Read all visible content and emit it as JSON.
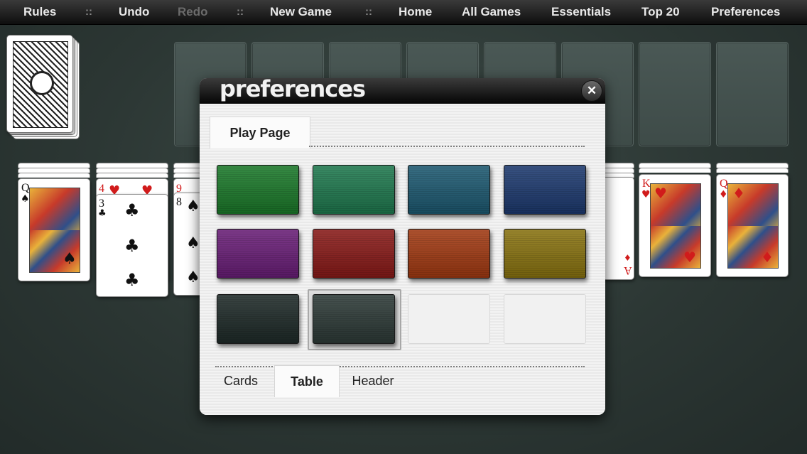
{
  "menu": {
    "rules": "Rules",
    "sep1": "::",
    "undo": "Undo",
    "redo": "Redo",
    "sep2": "::",
    "new_game": "New Game",
    "sep3": "::",
    "home": "Home",
    "all_games": "All Games",
    "essentials": "Essentials",
    "top20": "Top 20",
    "preferences": "Preferences"
  },
  "tableau": {
    "col1": {
      "rank": "Q",
      "suit": "♠",
      "color": "black"
    },
    "col2_top": {
      "rank": "4",
      "suit": "♥",
      "color": "red"
    },
    "col2": {
      "rank": "3",
      "suit": "♣",
      "color": "black"
    },
    "col3_top": {
      "rank": "9",
      "suit": "♥",
      "color": "red"
    },
    "col3": {
      "rank": "8",
      "suit": "♠",
      "color": "black"
    },
    "col7_partial": {
      "rank": "A",
      "suit": "♦",
      "color": "red"
    },
    "col8": {
      "rank": "K",
      "suit": "♥",
      "color": "red"
    },
    "col9": {
      "rank": "Q",
      "suit": "♦",
      "color": "red"
    }
  },
  "dialog": {
    "title": "preferences",
    "close_icon": "✕",
    "top_tab": "Play Page",
    "bottom_tabs": [
      "Cards",
      "Table",
      "Header"
    ],
    "active_bottom_tab": "Table",
    "selected_swatch_index": 9,
    "swatches": [
      {
        "name": "green",
        "color": "#1b7a2a"
      },
      {
        "name": "teal-green",
        "color": "#1f7a4f"
      },
      {
        "name": "teal-blue",
        "color": "#1d5a72"
      },
      {
        "name": "navy",
        "color": "#1d3a70"
      },
      {
        "name": "purple",
        "color": "#6a1e78"
      },
      {
        "name": "red",
        "color": "#8a1a18"
      },
      {
        "name": "orange",
        "color": "#a33a12"
      },
      {
        "name": "olive-gold",
        "color": "#8a7410"
      },
      {
        "name": "dark-charcoal",
        "color": "#1e2a28"
      },
      {
        "name": "slate-green",
        "color": "#2d3a37"
      },
      {
        "name": "empty-1",
        "color": ""
      },
      {
        "name": "empty-2",
        "color": ""
      }
    ]
  }
}
